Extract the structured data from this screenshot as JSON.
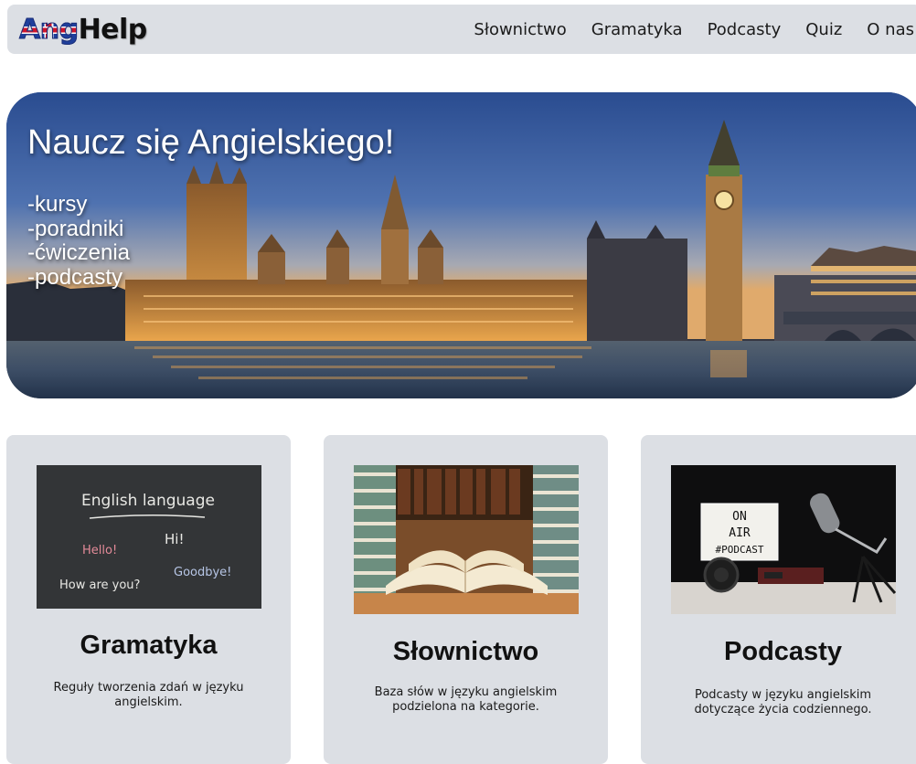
{
  "site": {
    "logo": {
      "part1": "Ang",
      "part2": "Help"
    }
  },
  "nav": {
    "items": [
      {
        "label": "Słownictwo"
      },
      {
        "label": "Gramatyka"
      },
      {
        "label": "Podcasty"
      },
      {
        "label": "Quiz"
      },
      {
        "label": "O nas"
      }
    ]
  },
  "hero": {
    "title": "Naucz się Angielskiego!",
    "list": [
      "-kursy",
      "-poradniki",
      "-ćwiczenia",
      "-podcasty"
    ]
  },
  "cards": [
    {
      "title": "Gramatyka",
      "description": "Reguły tworzenia zdań w języku angielskim.",
      "image_text": {
        "heading": "English language",
        "hi": "Hi!",
        "hello": "Hello!",
        "goodbye": "Goodbye!",
        "how": "How are you?"
      }
    },
    {
      "title": "Słownictwo",
      "description": "Baza słów w języku angielskim podzielona na kategorie."
    },
    {
      "title": "Podcasty",
      "description": "Podcasty w języku angielskim dotyczące życia codziennego.",
      "image_text": {
        "line1": "ON",
        "line2": "AIR",
        "line3": "#PODCAST"
      }
    }
  ],
  "colors": {
    "navbar_bg": "#dcdfe4",
    "card_bg": "#dcdfe4",
    "text": "#111111"
  }
}
